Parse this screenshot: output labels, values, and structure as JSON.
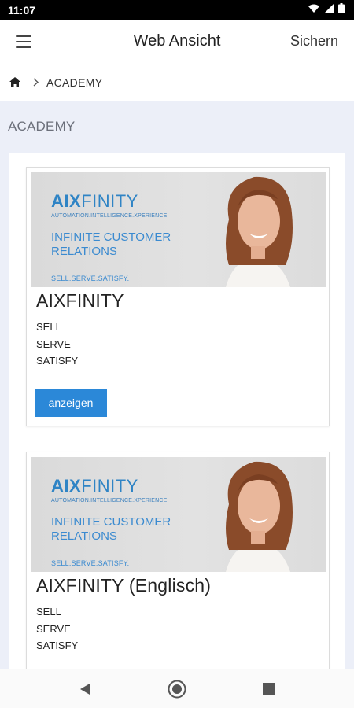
{
  "status_bar": {
    "time": "11:07"
  },
  "app_bar": {
    "title": "Web Ansicht",
    "save_label": "Sichern"
  },
  "breadcrumb": {
    "current": "ACADEMY"
  },
  "section": {
    "title": "ACADEMY"
  },
  "cards": [
    {
      "banner": {
        "brand_bold": "AIX",
        "brand_rest": "FINITY",
        "brand_sub": "AUTOMATION.INTELLIGENCE.XPERIENCE.",
        "headline": "INFINITE CUSTOMER RELATIONS",
        "tagline": "SELL.SERVE.SATISFY."
      },
      "title": "AIXFINITY",
      "lines": [
        "SELL",
        "SERVE",
        "SATISFY"
      ],
      "button_label": "anzeigen"
    },
    {
      "banner": {
        "brand_bold": "AIX",
        "brand_rest": "FINITY",
        "brand_sub": "AUTOMATION.INTELLIGENCE.XPERIENCE.",
        "headline": "INFINITE CUSTOMER RELATIONS",
        "tagline": "SELL.SERVE.SATISFY."
      },
      "title": "AIXFINITY (Englisch)",
      "lines": [
        "SELL",
        "SERVE",
        "SATISFY"
      ]
    }
  ],
  "icons": {
    "menu": "hamburger-icon",
    "home": "home-icon",
    "separator": "chevron-right-icon",
    "nav_back": "back-triangle-icon",
    "nav_home": "home-circle-icon",
    "nav_recents": "recents-square-icon"
  },
  "colors": {
    "accent": "#2b88d8",
    "brand": "#2f84c5",
    "page_bg": "#eceff8"
  }
}
